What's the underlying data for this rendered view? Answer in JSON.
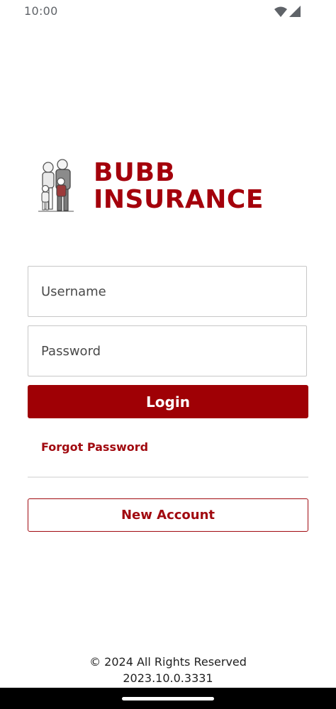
{
  "status_bar": {
    "time": "10:00",
    "icons": [
      "wifi-icon",
      "cellular-signal-icon"
    ]
  },
  "logo": {
    "line1": "BUBB",
    "line2": "INSURANCE",
    "brand_color": "#a4000b"
  },
  "login_form": {
    "username_placeholder": "Username",
    "username_value": "",
    "password_placeholder": "Password",
    "password_value": "",
    "login_label": "Login",
    "forgot_password_label": "Forgot Password",
    "new_account_label": "New Account",
    "accent_color": "#9f0005"
  },
  "footer": {
    "copyright": "© 2024 All Rights Reserved",
    "version": "2023.10.0.3331"
  }
}
